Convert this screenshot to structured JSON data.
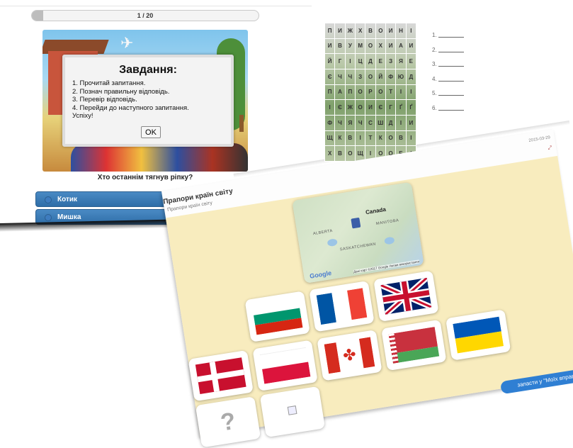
{
  "quiz": {
    "progress_text": "1 / 20",
    "progress_fraction": 0.05,
    "dialog_title": "Завдання:",
    "dialog_lines": [
      "1. Прочитай запитання.",
      "2. Познач правильну відповідь.",
      "3. Перевір відповідь.",
      "4. Перейди до наступного запитання.",
      "Успіху!"
    ],
    "ok_label": "OK",
    "question": "Хто останнім тягнув ріпку?",
    "answers": [
      "Котик",
      "Мишка"
    ]
  },
  "wordgrid": {
    "rows": [
      [
        "П",
        "И",
        "Ж",
        "Х",
        "В",
        "О",
        "И",
        "Н",
        "І"
      ],
      [
        "И",
        "В",
        "У",
        "М",
        "О",
        "Х",
        "И",
        "А",
        "И"
      ],
      [
        "Й",
        "Г",
        "І",
        "Ц",
        "Д",
        "Е",
        "З",
        "Я",
        "Е"
      ],
      [
        "Є",
        "Ч",
        "Ч",
        "З",
        "О",
        "Й",
        "Ф",
        "Ю",
        "Д"
      ],
      [
        "П",
        "А",
        "П",
        "О",
        "Р",
        "О",
        "Т",
        "І",
        "І"
      ],
      [
        "І",
        "Є",
        "Ж",
        "О",
        "И",
        "Є",
        "Г",
        "Ґ",
        "Ґ"
      ],
      [
        "Ф",
        "Ч",
        "Я",
        "Ч",
        "С",
        "Ш",
        "Д",
        "І",
        "И"
      ],
      [
        "Щ",
        "К",
        "В",
        "І",
        "Т",
        "К",
        "О",
        "В",
        "І"
      ],
      [
        "Х",
        "В",
        "О",
        "Щ",
        "І",
        "О",
        "О",
        "Е",
        "І"
      ]
    ],
    "blank_numbers": [
      "1.",
      "2.",
      "3.",
      "4.",
      "5.",
      "6."
    ]
  },
  "flags_page": {
    "title": "Прапори країн світу",
    "subtitle": "Прапори країн світу",
    "date": "2015-03-29",
    "map": {
      "country_label": "Canada",
      "labels": [
        "ALBERTA",
        "MANITOBA",
        "SASKATCHEWAN"
      ],
      "google_label": "Google",
      "attribution": "Дані карт ©2017 Google   Умови використання"
    },
    "flags": [
      "denmark",
      "poland",
      "bulgaria",
      "france",
      "united-kingdom",
      "canada",
      "belarus",
      "ukraine"
    ],
    "save_label": "запасти у \"Моїх вправах\""
  },
  "colors": {
    "answer_blue": "#2f6ea8",
    "board": "#f8ecbe",
    "accent_blue": "#2f7fd3"
  }
}
